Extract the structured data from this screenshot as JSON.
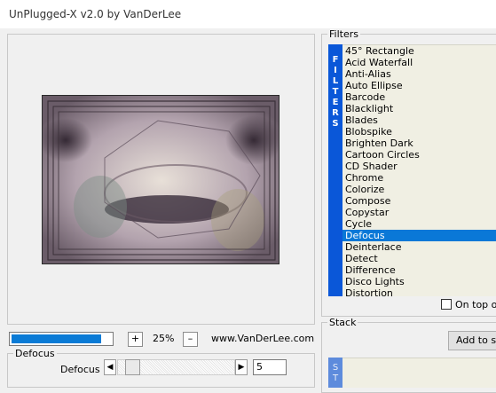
{
  "window": {
    "title": "UnPlugged-X v2.0 by VanDerLee"
  },
  "preview": {
    "progress_fraction": 0.9,
    "zoom_in_label": "+",
    "zoom_value": "25%",
    "zoom_out_label": "–",
    "website": "www.VanDerLee.com"
  },
  "defocus": {
    "group_label": "Defocus",
    "param_label": "Defocus",
    "left_arrow": "◀",
    "right_arrow": "▶",
    "value": "5",
    "slider_fraction": 0.08
  },
  "filters": {
    "group_label": "Filters",
    "side_letters": [
      "F",
      "I",
      "L",
      "T",
      "E",
      "R",
      "S"
    ],
    "items": [
      "45° Rectangle",
      "Acid Waterfall",
      "Anti-Alias",
      "Auto Ellipse",
      "Barcode",
      "Blacklight",
      "Blades",
      "Blobspike",
      "Brighten Dark",
      "Cartoon Circles",
      "CD Shader",
      "Chrome",
      "Colorize",
      "Compose",
      "Copystar",
      "Cycle",
      "Defocus",
      "Deinterlace",
      "Detect",
      "Difference",
      "Disco Lights",
      "Distortion"
    ],
    "selected": "Defocus",
    "on_top_label": "On top of"
  },
  "stack": {
    "group_label": "Stack",
    "add_button": "Add to stack",
    "side_letters": [
      "S",
      "T"
    ]
  },
  "colors": {
    "accent_blue": "#0a57d8",
    "selection_blue": "#0a78d7",
    "progress_blue": "#0a7bd6",
    "list_background": "#f0efe3"
  }
}
